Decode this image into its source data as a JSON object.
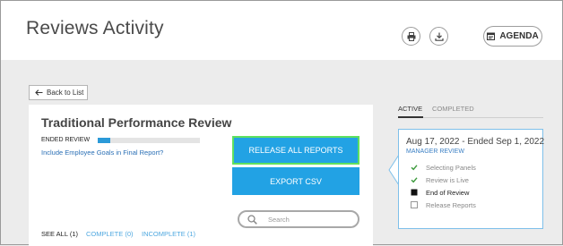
{
  "header": {
    "title": "Reviews Activity",
    "agenda_label": "AGENDA",
    "icons": [
      "print-icon",
      "download-icon",
      "calendar-icon"
    ]
  },
  "back_button": {
    "label": "Back to List"
  },
  "review": {
    "title": "Traditional Performance Review",
    "status": "ENDED REVIEW",
    "progress_percent": 12,
    "goals_link": "Include Employee Goals in Final Report?",
    "release_button": "RELEASE ALL REPORTS",
    "export_button": "EXPORT CSV",
    "search_placeholder": "Search",
    "filters": {
      "see_all": "SEE ALL (1)",
      "complete": "COMPLETE (0)",
      "incomplete": "INCOMPLETE (1)"
    }
  },
  "tabs": {
    "active": "ACTIVE",
    "completed": "COMPLETED"
  },
  "timeline": {
    "date_range": "Aug 17, 2022 - Ended Sep 1, 2022",
    "phase": "MANAGER REVIEW",
    "steps": [
      {
        "label": "Selecting Panels",
        "state": "done"
      },
      {
        "label": "Review is Live",
        "state": "done"
      },
      {
        "label": "End of Review",
        "state": "current"
      },
      {
        "label": "Release Reports",
        "state": "pending"
      }
    ]
  },
  "colors": {
    "accent_blue": "#22a2e4",
    "highlight_green": "#5fe05f",
    "check_green": "#3c9a3c",
    "link_blue": "#2a6fb5"
  }
}
